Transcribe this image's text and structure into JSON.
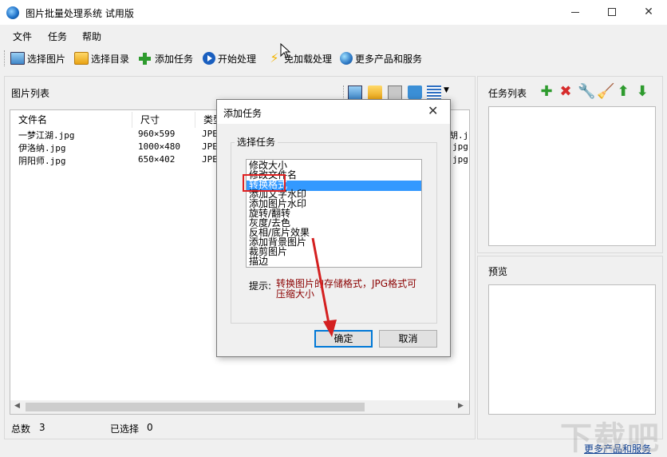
{
  "window": {
    "title": "图片批量处理系统 试用版"
  },
  "menu": [
    "文件",
    "任务",
    "帮助"
  ],
  "toolbar": {
    "select_image": "选择图片",
    "select_dir": "选择目录",
    "add_task": "添加任务",
    "start_process": "开始处理",
    "no_load_process": "免加载处理",
    "more_products": "更多产品和服务"
  },
  "image_list": {
    "label": "图片列表",
    "columns": [
      "文件名",
      "尺寸",
      "类型"
    ],
    "rows": [
      {
        "name": "一梦江湖.jpg",
        "size": "960×599",
        "type": "JPE",
        "tail": "胡.j"
      },
      {
        "name": "伊洛纳.jpg",
        "size": "1000×480",
        "type": "JPE",
        "tail": "jpg"
      },
      {
        "name": "阴阳师.jpg",
        "size": "650×402",
        "type": "JPE",
        "tail": "jpg"
      }
    ]
  },
  "task_panel": {
    "label": "任务列表"
  },
  "preview_panel": {
    "label": "预览"
  },
  "status": {
    "total_label": "总数",
    "total_value": "3",
    "selected_label": "已选择",
    "selected_value": "0"
  },
  "footer_link": "更多产品和服务",
  "dialog": {
    "title": "添加任务",
    "group_label": "选择任务",
    "tasks": [
      "修改大小",
      "修改文件名",
      "转换格式",
      "添加文字水印",
      "添加图片水印",
      "旋转/翻转",
      "灰度/去色",
      "反相/底片效果",
      "添加背景图片",
      "裁剪图片",
      "描边"
    ],
    "selected_task": "转换格式",
    "hint_label": "提示:",
    "hint_text": "转换图片的存储格式，JPG格式可压缩大小",
    "ok": "确定",
    "cancel": "取消"
  },
  "watermark": "下载吧",
  "colors": {
    "selection": "#3399ff",
    "highlight_box": "#e02020",
    "hint": "#8b0000",
    "arrow": "#d42020"
  }
}
